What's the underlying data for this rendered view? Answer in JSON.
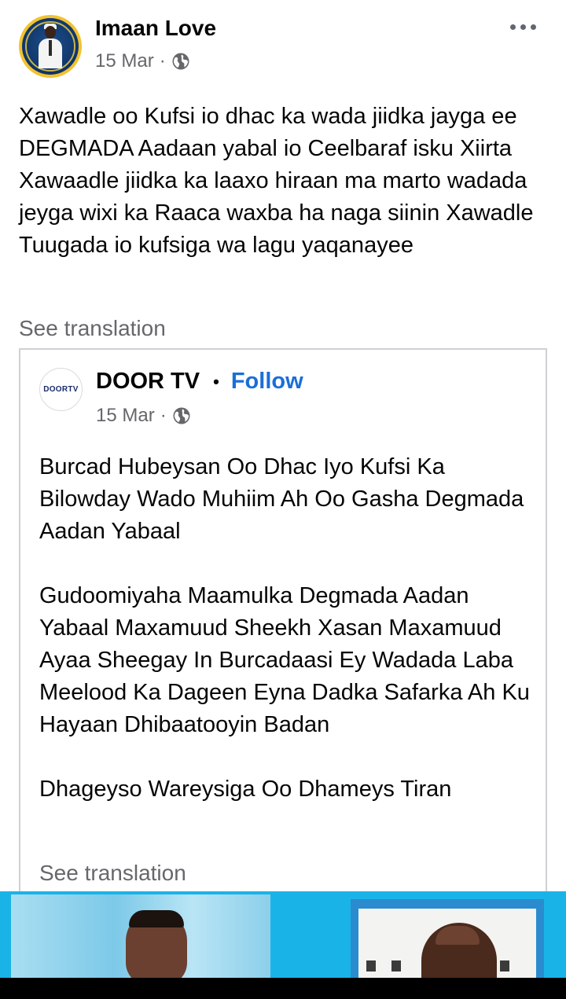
{
  "post": {
    "author": "Imaan Love",
    "date": "15 Mar",
    "meta_separator": "·",
    "privacy_icon": "globe-icon",
    "text": "Xawadle oo Kufsi io dhac ka wada jiidka jayga ee DEGMADA Aadaan yabal io Ceelbaraf isku Xiirta Xawaadle jiidka ka laaxo hiraan ma marto wadada jeyga wixi ka Raaca waxba ha naga siinin Xawadle Tuugada io kufsiga wa lagu yaqanayee",
    "see_translation": "See translation",
    "more_icon": "more-options-icon"
  },
  "shared": {
    "avatar_text": "DOORTV",
    "page_name": "DOOR TV",
    "separator": "•",
    "follow_label": "Follow",
    "date": "15 Mar",
    "meta_separator": "·",
    "privacy_icon": "globe-icon",
    "paragraphs": [
      "Burcad Hubeysan Oo Dhac Iyo  Kufsi Ka Bilowday Wado Muhiim Ah Oo Gasha Degmada Aadan Yabaal",
      "Gudoomiyaha Maamulka Degmada Aadan Yabaal Maxamuud Sheekh Xasan Maxamuud Ayaa Sheegay In Burcadaasi Ey Wadada Laba Meelood Ka Dageen Eyna Dadka Safarka Ah Ku Hayaan Dhibaatooyin Badan",
      "Dhageyso Wareysiga Oo Dhameys Tiran"
    ],
    "see_translation": "See translation"
  },
  "colors": {
    "link": "#1a6ed8",
    "muted": "#65676b",
    "text": "#050505",
    "media_bg": "#1ab3e8"
  }
}
